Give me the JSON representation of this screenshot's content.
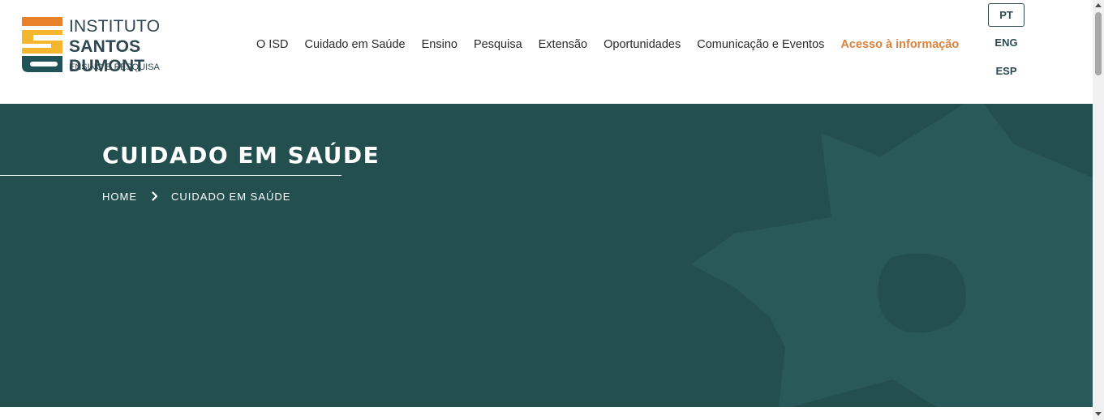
{
  "colors": {
    "brand_teal": "#1f5358",
    "brand_orange": "#e8822a",
    "brand_yellow": "#f3b62d",
    "accent_link": "#d9833f",
    "hero_background": "#234f4f",
    "hero_shape": "#2a5959"
  },
  "logo": {
    "line1": "INSTITUTO",
    "line2": "SANTOS DUMONT",
    "line3": "ENSINO E PESQUISA"
  },
  "nav": {
    "items": [
      {
        "label": "O ISD"
      },
      {
        "label": "Cuidado em Saúde"
      },
      {
        "label": "Ensino"
      },
      {
        "label": "Pesquisa"
      },
      {
        "label": "Extensão"
      },
      {
        "label": "Oportunidades"
      },
      {
        "label": "Comunicação e Eventos"
      },
      {
        "label": "Acesso à informação"
      }
    ]
  },
  "languages": [
    {
      "label": "PT",
      "active": true
    },
    {
      "label": "ENG",
      "active": false
    },
    {
      "label": "ESP",
      "active": false
    }
  ],
  "hero": {
    "title": "CUIDADO EM SAÚDE",
    "breadcrumb": {
      "home": "HOME",
      "separator_icon": "chevron-right-icon",
      "current": "CUIDADO EM SAÚDE"
    }
  }
}
